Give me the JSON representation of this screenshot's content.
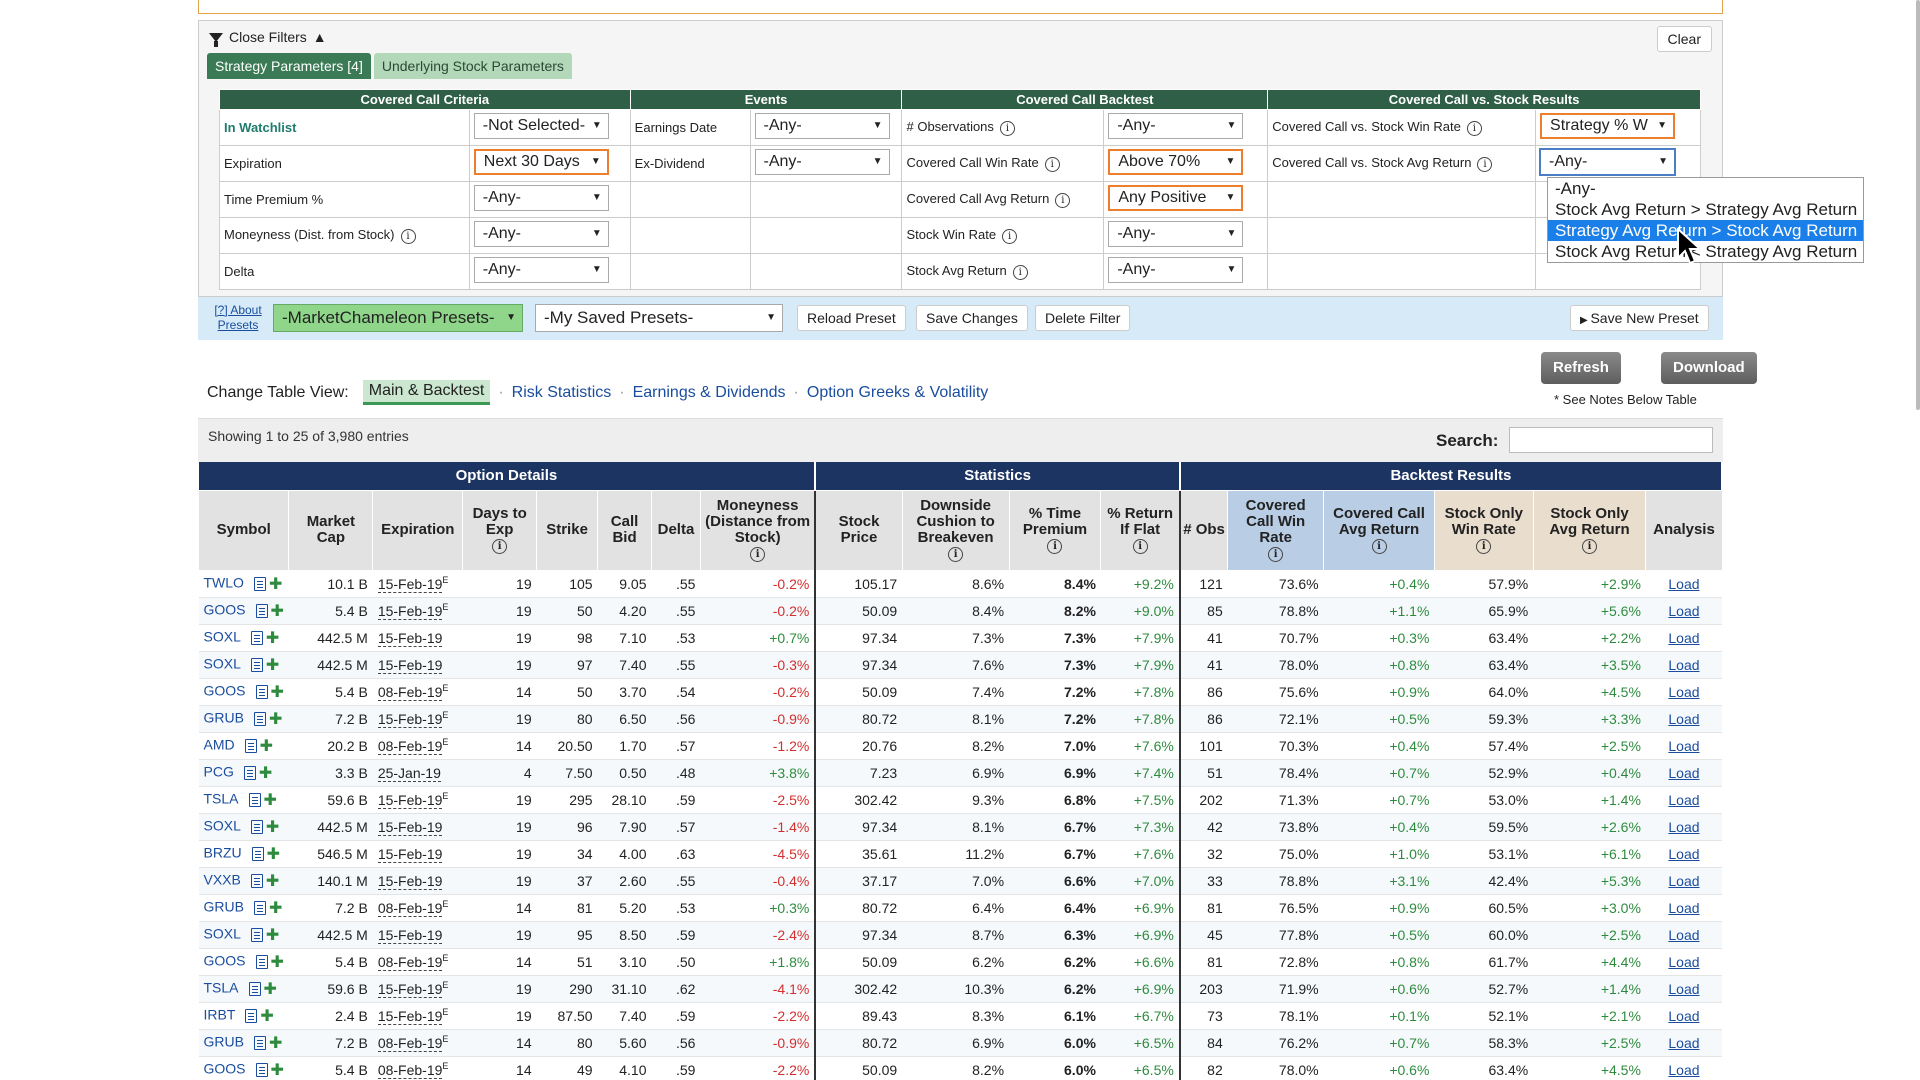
{
  "filters": {
    "close_label": "Close Filters",
    "clear_label": "Clear",
    "tabs": [
      "Strategy Parameters [4]",
      "Underlying Stock Parameters"
    ],
    "headers": [
      "Covered Call Criteria",
      "Events",
      "Covered Call Backtest",
      "Covered Call vs. Stock Results"
    ],
    "rows": [
      {
        "c1": "In Watchlist",
        "v1": "-Not Selected-",
        "c2": "Earnings Date",
        "v2": "-Any-",
        "c3": "# Observations",
        "v3": "-Any-",
        "c4": "Covered Call vs. Stock Win Rate",
        "v4": "Strategy % W"
      },
      {
        "c1": "Expiration",
        "v1": "Next 30 Days",
        "c2": "Ex-Dividend",
        "v2": "-Any-",
        "c3": "Covered Call Win Rate",
        "v3": "Above 70%",
        "c4": "Covered Call vs. Stock Avg Return",
        "v4": "-Any-"
      },
      {
        "c1": "Time Premium %",
        "v1": "-Any-",
        "c3": "Covered Call Avg Return",
        "v3": "Any Positive"
      },
      {
        "c1": "Moneyness (Dist. from Stock)",
        "v1": "-Any-",
        "c3": "Stock Win Rate",
        "v3": "-Any-"
      },
      {
        "c1": "Delta",
        "v1": "-Any-",
        "c3": "Stock Avg Return",
        "v3": "-Any-"
      }
    ],
    "dropdown_options": [
      "-Any-",
      "Stock Avg Return > Strategy Avg Return",
      "Strategy Avg Return > Stock Avg Return",
      "Stock Avg Return < Strategy Avg Return"
    ]
  },
  "presets": {
    "about": "[?] About Presets",
    "mc_presets": "-MarketChameleon Presets-",
    "my_presets": "-My Saved Presets-",
    "reload": "Reload Preset",
    "save_changes": "Save Changes",
    "delete": "Delete Filter",
    "save_new": "Save New Preset"
  },
  "table_view": {
    "label": "Change Table View:",
    "views": [
      "Main & Backtest",
      "Risk Statistics",
      "Earnings & Dividends",
      "Option Greeks & Volatility"
    ]
  },
  "actions": {
    "refresh": "Refresh",
    "download": "Download",
    "notes": "* See Notes Below Table"
  },
  "info": {
    "showing": "Showing 1 to 25 of 3,980 entries",
    "search_label": "Search:"
  },
  "table": {
    "groups": [
      "Option Details",
      "Statistics",
      "Backtest Results"
    ],
    "columns": [
      "Symbol",
      "Market Cap",
      "Expiration",
      "Days to Exp",
      "Strike",
      "Call Bid",
      "Delta",
      "Moneyness (Distance from Stock)",
      "Stock Price",
      "Downside Cushion to Breakeven",
      "% Time Premium",
      "% Return If Flat",
      "# Obs",
      "Covered Call Win Rate",
      "Covered Call Avg Return",
      "Stock Only Win Rate",
      "Stock Only Avg Return",
      "Analysis"
    ],
    "rows": [
      [
        "TWLO",
        "10.1 B",
        "15-Feb-19",
        "E",
        "19",
        "105",
        "9.05",
        ".55",
        "-0.2%",
        "105.17",
        "8.6%",
        "8.4%",
        "+9.2%",
        "121",
        "73.6%",
        "+0.4%",
        "57.9%",
        "+2.9%",
        "Load"
      ],
      [
        "GOOS",
        "5.4 B",
        "15-Feb-19",
        "E",
        "19",
        "50",
        "4.20",
        ".55",
        "-0.2%",
        "50.09",
        "8.4%",
        "8.2%",
        "+9.0%",
        "85",
        "78.8%",
        "+1.1%",
        "65.9%",
        "+5.6%",
        "Load"
      ],
      [
        "SOXL",
        "442.5 M",
        "15-Feb-19",
        "",
        "19",
        "98",
        "7.10",
        ".53",
        "+0.7%",
        "97.34",
        "7.3%",
        "7.3%",
        "+7.9%",
        "41",
        "70.7%",
        "+0.3%",
        "63.4%",
        "+2.2%",
        "Load"
      ],
      [
        "SOXL",
        "442.5 M",
        "15-Feb-19",
        "",
        "19",
        "97",
        "7.40",
        ".55",
        "-0.3%",
        "97.34",
        "7.6%",
        "7.3%",
        "+7.9%",
        "41",
        "78.0%",
        "+0.8%",
        "63.4%",
        "+3.5%",
        "Load"
      ],
      [
        "GOOS",
        "5.4 B",
        "08-Feb-19",
        "E",
        "14",
        "50",
        "3.70",
        ".54",
        "-0.2%",
        "50.09",
        "7.4%",
        "7.2%",
        "+7.8%",
        "86",
        "75.6%",
        "+0.9%",
        "64.0%",
        "+4.5%",
        "Load"
      ],
      [
        "GRUB",
        "7.2 B",
        "15-Feb-19",
        "E",
        "19",
        "80",
        "6.50",
        ".56",
        "-0.9%",
        "80.72",
        "8.1%",
        "7.2%",
        "+7.8%",
        "86",
        "72.1%",
        "+0.5%",
        "59.3%",
        "+3.3%",
        "Load"
      ],
      [
        "AMD",
        "20.2 B",
        "08-Feb-19",
        "E",
        "14",
        "20.50",
        "1.70",
        ".57",
        "-1.2%",
        "20.76",
        "8.2%",
        "7.0%",
        "+7.6%",
        "101",
        "70.3%",
        "+0.4%",
        "57.4%",
        "+2.5%",
        "Load"
      ],
      [
        "PCG",
        "3.3 B",
        "25-Jan-19",
        "",
        "4",
        "7.50",
        "0.50",
        ".48",
        "+3.8%",
        "7.23",
        "6.9%",
        "6.9%",
        "+7.4%",
        "51",
        "78.4%",
        "+0.7%",
        "52.9%",
        "+0.4%",
        "Load"
      ],
      [
        "TSLA",
        "59.6 B",
        "15-Feb-19",
        "E",
        "19",
        "295",
        "28.10",
        ".59",
        "-2.5%",
        "302.42",
        "9.3%",
        "6.8%",
        "+7.5%",
        "202",
        "71.3%",
        "+0.7%",
        "53.0%",
        "+1.4%",
        "Load"
      ],
      [
        "SOXL",
        "442.5 M",
        "15-Feb-19",
        "",
        "19",
        "96",
        "7.90",
        ".57",
        "-1.4%",
        "97.34",
        "8.1%",
        "6.7%",
        "+7.3%",
        "42",
        "73.8%",
        "+0.4%",
        "59.5%",
        "+2.6%",
        "Load"
      ],
      [
        "BRZU",
        "546.5 M",
        "15-Feb-19",
        "",
        "19",
        "34",
        "4.00",
        ".63",
        "-4.5%",
        "35.61",
        "11.2%",
        "6.7%",
        "+7.6%",
        "32",
        "75.0%",
        "+1.0%",
        "53.1%",
        "+6.1%",
        "Load"
      ],
      [
        "VXXB",
        "140.1 M",
        "15-Feb-19",
        "",
        "19",
        "37",
        "2.60",
        ".55",
        "-0.4%",
        "37.17",
        "7.0%",
        "6.6%",
        "+7.0%",
        "33",
        "78.8%",
        "+3.1%",
        "42.4%",
        "+5.3%",
        "Load"
      ],
      [
        "GRUB",
        "7.2 B",
        "08-Feb-19",
        "E",
        "14",
        "81",
        "5.20",
        ".53",
        "+0.3%",
        "80.72",
        "6.4%",
        "6.4%",
        "+6.9%",
        "81",
        "76.5%",
        "+0.9%",
        "60.5%",
        "+3.0%",
        "Load"
      ],
      [
        "SOXL",
        "442.5 M",
        "15-Feb-19",
        "",
        "19",
        "95",
        "8.50",
        ".59",
        "-2.4%",
        "97.34",
        "8.7%",
        "6.3%",
        "+6.9%",
        "45",
        "77.8%",
        "+0.5%",
        "60.0%",
        "+2.5%",
        "Load"
      ],
      [
        "GOOS",
        "5.4 B",
        "08-Feb-19",
        "E",
        "14",
        "51",
        "3.10",
        ".50",
        "+1.8%",
        "50.09",
        "6.2%",
        "6.2%",
        "+6.6%",
        "81",
        "72.8%",
        "+0.8%",
        "61.7%",
        "+4.4%",
        "Load"
      ],
      [
        "TSLA",
        "59.6 B",
        "15-Feb-19",
        "E",
        "19",
        "290",
        "31.10",
        ".62",
        "-4.1%",
        "302.42",
        "10.3%",
        "6.2%",
        "+6.9%",
        "203",
        "71.9%",
        "+0.6%",
        "52.7%",
        "+1.4%",
        "Load"
      ],
      [
        "IRBT",
        "2.4 B",
        "15-Feb-19",
        "E",
        "19",
        "87.50",
        "7.40",
        ".59",
        "-2.2%",
        "89.43",
        "8.3%",
        "6.1%",
        "+6.7%",
        "73",
        "78.1%",
        "+0.1%",
        "52.1%",
        "+2.1%",
        "Load"
      ],
      [
        "GRUB",
        "7.2 B",
        "08-Feb-19",
        "E",
        "14",
        "80",
        "5.60",
        ".56",
        "-0.9%",
        "80.72",
        "6.9%",
        "6.0%",
        "+6.5%",
        "84",
        "76.2%",
        "+0.7%",
        "58.3%",
        "+2.5%",
        "Load"
      ],
      [
        "GOOS",
        "5.4 B",
        "08-Feb-19",
        "E",
        "14",
        "49",
        "4.10",
        ".59",
        "-2.2%",
        "50.09",
        "8.2%",
        "6.0%",
        "+6.5%",
        "82",
        "78.0%",
        "+0.6%",
        "63.4%",
        "+4.5%",
        "Load"
      ]
    ]
  }
}
